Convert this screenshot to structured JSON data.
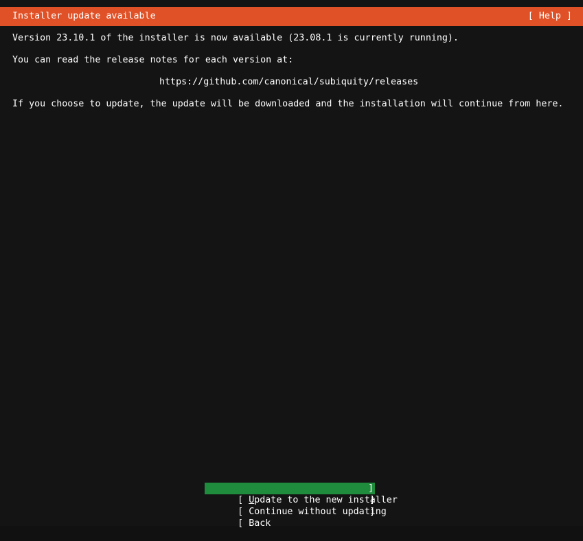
{
  "header": {
    "title": "Installer update available",
    "help_label": "[ Help ]",
    "bar_color": "#e05127"
  },
  "body": {
    "intro": "Version 23.10.1 of the installer is now available (23.08.1 is currently running).",
    "release_notes_lead": "You can read the release notes for each version at:",
    "release_notes_url": "https://github.com/canonical/subiquity/releases",
    "outcome": "If you choose to update, the update will be downloaded and the installation will continue from here."
  },
  "versions": {
    "available": "23.10.1",
    "running": "23.08.1"
  },
  "buttons": {
    "selected_index": 0,
    "highlight_color": "#1f8b3c",
    "items": [
      {
        "bracket_left": "[",
        "accel": "U",
        "label_rest": "pdate to the new installer",
        "full_label": "Update to the new installer",
        "bracket_right": "]",
        "selected": true
      },
      {
        "bracket_left": "[",
        "accel": "",
        "label_rest": "Continue without updating",
        "full_label": "Continue without updating",
        "bracket_right": "]",
        "selected": false
      },
      {
        "bracket_left": "[",
        "accel": "",
        "label_rest": "Back",
        "full_label": "Back",
        "bracket_right": "]",
        "selected": false
      }
    ]
  },
  "theme": {
    "background": "#141414",
    "foreground": "#ffffff"
  }
}
